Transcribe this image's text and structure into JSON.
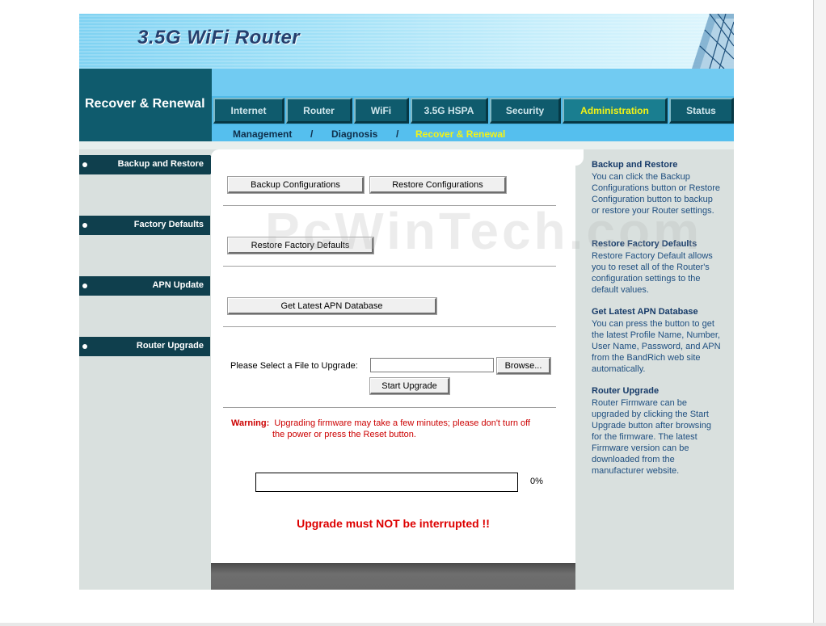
{
  "app": {
    "title": "3.5G WiFi Router"
  },
  "section_title": "Recover & Renewal",
  "tabs": [
    {
      "label": "Internet",
      "active": false
    },
    {
      "label": "Router",
      "active": false
    },
    {
      "label": "WiFi",
      "active": false
    },
    {
      "label": "3.5G HSPA",
      "active": false
    },
    {
      "label": "Security",
      "active": false
    },
    {
      "label": "Administration",
      "active": true
    },
    {
      "label": "Status",
      "active": false
    }
  ],
  "subnav": {
    "items": [
      "Management",
      "Diagnosis",
      "Recover & Renewal"
    ],
    "separator": "/",
    "active": "Recover & Renewal"
  },
  "sidebar": {
    "items": [
      {
        "label": "Backup and Restore",
        "active": true
      },
      {
        "label": "Factory Defaults",
        "active": false
      },
      {
        "label": "APN Update",
        "active": false
      },
      {
        "label": "Router Upgrade",
        "active": false
      }
    ]
  },
  "main": {
    "backup_button": "Backup Configurations",
    "restore_button": "Restore Configurations",
    "factory_button": "Restore Factory Defaults",
    "apn_button": "Get Latest APN Database",
    "file_label": "Please Select a File to Upgrade:",
    "file_value": "",
    "browse_button": "Browse...",
    "upgrade_button": "Start Upgrade",
    "warning_label": "Warning:",
    "warning_line1": "Upgrading firmware may take a few minutes; please don't turn off",
    "warning_line2": "the power or press the Reset button.",
    "progress_percent": 0,
    "progress_text": "0%",
    "interrupt_notice": "Upgrade must NOT be interrupted !!"
  },
  "help": [
    {
      "title": "Backup and Restore",
      "text": "You can click the Backup Configurations button or Restore Configuration button to backup or restore your Router settings."
    },
    {
      "title": "Restore Factory Defaults",
      "text": "Restore Factory Default allows you to reset all of the Router's configuration settings to the default values."
    },
    {
      "title": "Get Latest APN Database",
      "text": "You can press the button to get the latest Profile Name, Number, User Name, Password, and APN from the BandRich web site automatically."
    },
    {
      "title": "Router Upgrade",
      "text": "Router Firmware can be upgraded by clicking the Start Upgrade button after browsing for the firmware. The latest Firmware version can be downloaded from the manufacturer website."
    }
  ],
  "watermark": "PcWinTech.com",
  "colors": {
    "accent": "#0f5b6d",
    "tab_active_text": "#f3f316",
    "warning": "#cc0000"
  }
}
